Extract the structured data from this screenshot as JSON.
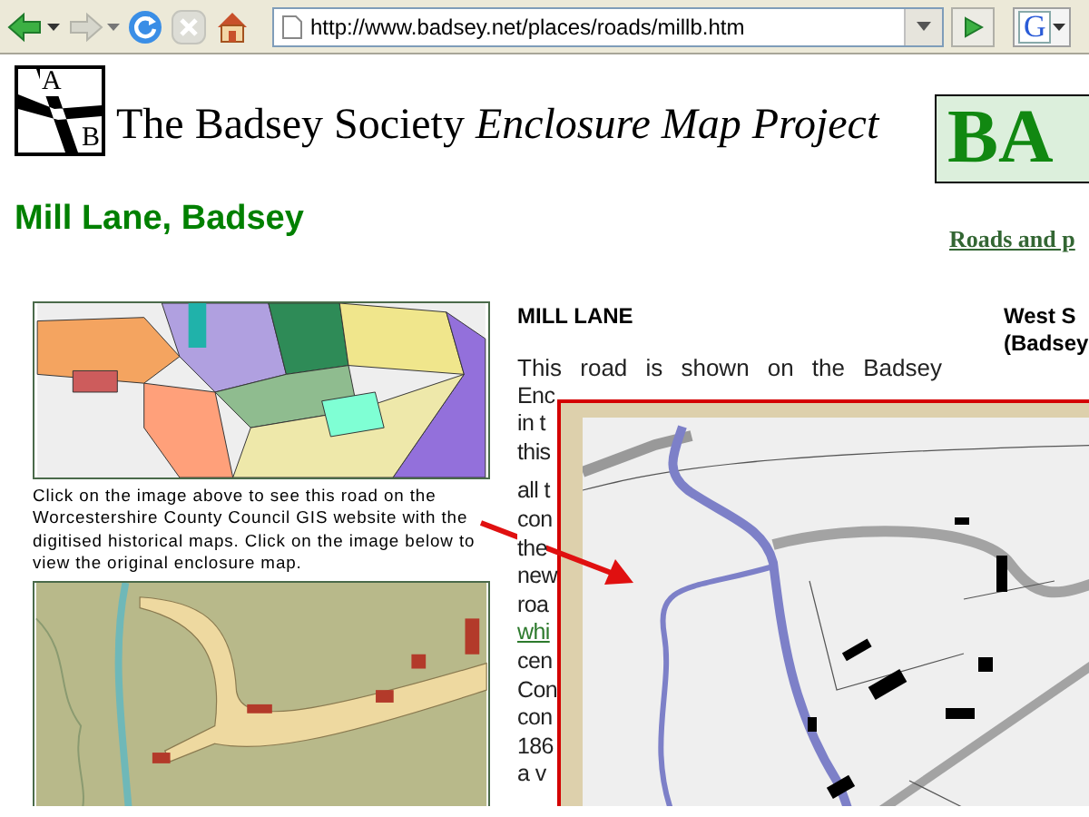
{
  "toolbar": {
    "address": "http://www.badsey.net/places/roads/millb.htm",
    "search_letter": "G"
  },
  "header": {
    "logo_letters": [
      "A",
      "B"
    ],
    "title": "The Badsey Society *Enclosure Map Project*",
    "banner": "BA"
  },
  "page_title": "Mill Lane, Badsey",
  "nav_link": "Roads and p",
  "left_column": {
    "caption": "Click on the image above to see this road on the Worcestershire County Council GIS website with the digitised historical maps. Click on the image below to view the original enclosure map."
  },
  "article": {
    "heading": "MILL LANE",
    "lines": [
      {
        "text": "This road is shown on the Badsey",
        "kind": "text"
      },
      {
        "text": "Enc",
        "kind": "text"
      },
      {
        "text": "in t",
        "kind": "text"
      },
      {
        "text": "this",
        "kind": "text"
      },
      {
        "text": "all t",
        "kind": "text"
      },
      {
        "text": "con",
        "kind": "text"
      },
      {
        "text": "the",
        "kind": "text"
      },
      {
        "text": "new",
        "kind": "text"
      },
      {
        "text": "roa",
        "kind": "text"
      },
      {
        "text": "whi",
        "kind": "link"
      },
      {
        "text": "cen",
        "kind": "text"
      },
      {
        "text": "Con",
        "kind": "text"
      },
      {
        "text": "con",
        "kind": "text"
      },
      {
        "text": "186",
        "kind": "text"
      },
      {
        "text": "a v",
        "kind": "text"
      }
    ]
  },
  "side_heading": [
    "West S",
    "(Badsey"
  ]
}
